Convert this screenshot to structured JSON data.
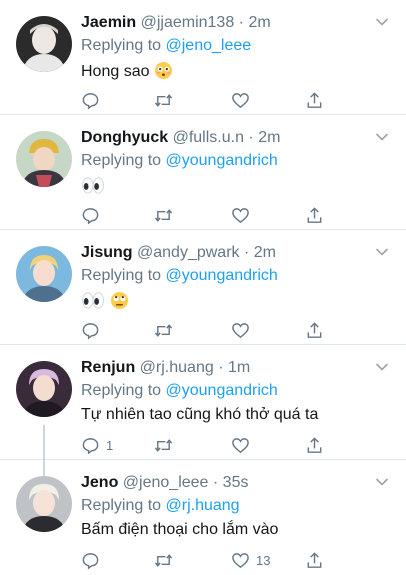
{
  "tweets": [
    {
      "name": "Jaemin",
      "handle": "@jjaemin138",
      "time": "· 2m",
      "reply_prefix": "Replying to ",
      "reply_to": "@jeno_leee",
      "text": "Hong sao",
      "emojis": [
        "flushed-face"
      ],
      "reply_count": "",
      "like_count": ""
    },
    {
      "name": "Donghyuck",
      "handle": "@fulls.u.n",
      "time": "· 2m",
      "reply_prefix": "Replying to ",
      "reply_to": "@youngandrich",
      "text": "",
      "emojis": [
        "eyes"
      ],
      "reply_count": "",
      "like_count": ""
    },
    {
      "name": "Jisung",
      "handle": "@andy_pwark",
      "time": "· 2m",
      "reply_prefix": "Replying to ",
      "reply_to": "@youngandrich",
      "text": "",
      "emojis": [
        "eyes",
        "rolling-eyes-face"
      ],
      "reply_count": "",
      "like_count": ""
    },
    {
      "name": "Renjun",
      "handle": "@rj.huang",
      "time": "· 1m",
      "reply_prefix": "Replying to ",
      "reply_to": "@youngandrich",
      "text": "Tự nhiên tao cũng khó thở quá ta",
      "emojis": [],
      "reply_count": "1",
      "like_count": ""
    },
    {
      "name": "Jeno",
      "handle": "@jeno_leee",
      "time": "· 35s",
      "reply_prefix": "Replying to ",
      "reply_to": "@rj.huang",
      "text": "Bấm điện thoại cho lắm vào",
      "emojis": [],
      "reply_count": "",
      "like_count": "13"
    }
  ],
  "colors": {
    "link": "#1da1f2",
    "muted": "#657786",
    "text": "#14171a",
    "divider": "#e1e8ed",
    "thread": "#ccd6dd"
  },
  "icons": {
    "reply": "speech-bubble-icon",
    "retweet": "retweet-icon",
    "like": "heart-icon",
    "share": "share-icon",
    "menu": "chevron-down-icon"
  }
}
